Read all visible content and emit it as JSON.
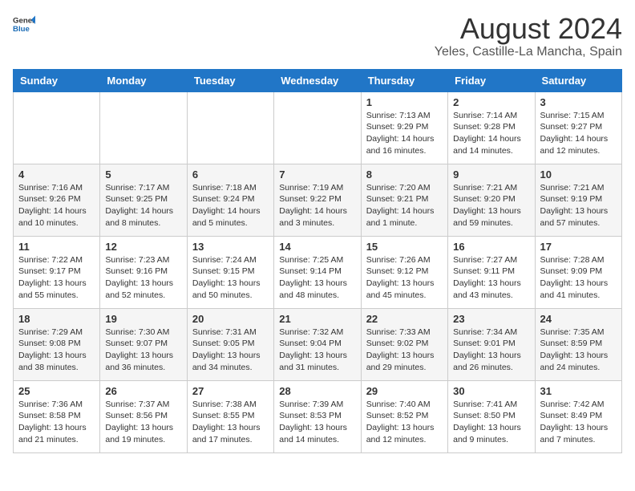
{
  "header": {
    "logo_general": "General",
    "logo_blue": "Blue",
    "title": "August 2024",
    "subtitle": "Yeles, Castille-La Mancha, Spain"
  },
  "days_of_week": [
    "Sunday",
    "Monday",
    "Tuesday",
    "Wednesday",
    "Thursday",
    "Friday",
    "Saturday"
  ],
  "weeks": [
    [
      {
        "day": "",
        "info": ""
      },
      {
        "day": "",
        "info": ""
      },
      {
        "day": "",
        "info": ""
      },
      {
        "day": "",
        "info": ""
      },
      {
        "day": "1",
        "info": "Sunrise: 7:13 AM\nSunset: 9:29 PM\nDaylight: 14 hours\nand 16 minutes."
      },
      {
        "day": "2",
        "info": "Sunrise: 7:14 AM\nSunset: 9:28 PM\nDaylight: 14 hours\nand 14 minutes."
      },
      {
        "day": "3",
        "info": "Sunrise: 7:15 AM\nSunset: 9:27 PM\nDaylight: 14 hours\nand 12 minutes."
      }
    ],
    [
      {
        "day": "4",
        "info": "Sunrise: 7:16 AM\nSunset: 9:26 PM\nDaylight: 14 hours\nand 10 minutes."
      },
      {
        "day": "5",
        "info": "Sunrise: 7:17 AM\nSunset: 9:25 PM\nDaylight: 14 hours\nand 8 minutes."
      },
      {
        "day": "6",
        "info": "Sunrise: 7:18 AM\nSunset: 9:24 PM\nDaylight: 14 hours\nand 5 minutes."
      },
      {
        "day": "7",
        "info": "Sunrise: 7:19 AM\nSunset: 9:22 PM\nDaylight: 14 hours\nand 3 minutes."
      },
      {
        "day": "8",
        "info": "Sunrise: 7:20 AM\nSunset: 9:21 PM\nDaylight: 14 hours\nand 1 minute."
      },
      {
        "day": "9",
        "info": "Sunrise: 7:21 AM\nSunset: 9:20 PM\nDaylight: 13 hours\nand 59 minutes."
      },
      {
        "day": "10",
        "info": "Sunrise: 7:21 AM\nSunset: 9:19 PM\nDaylight: 13 hours\nand 57 minutes."
      }
    ],
    [
      {
        "day": "11",
        "info": "Sunrise: 7:22 AM\nSunset: 9:17 PM\nDaylight: 13 hours\nand 55 minutes."
      },
      {
        "day": "12",
        "info": "Sunrise: 7:23 AM\nSunset: 9:16 PM\nDaylight: 13 hours\nand 52 minutes."
      },
      {
        "day": "13",
        "info": "Sunrise: 7:24 AM\nSunset: 9:15 PM\nDaylight: 13 hours\nand 50 minutes."
      },
      {
        "day": "14",
        "info": "Sunrise: 7:25 AM\nSunset: 9:14 PM\nDaylight: 13 hours\nand 48 minutes."
      },
      {
        "day": "15",
        "info": "Sunrise: 7:26 AM\nSunset: 9:12 PM\nDaylight: 13 hours\nand 45 minutes."
      },
      {
        "day": "16",
        "info": "Sunrise: 7:27 AM\nSunset: 9:11 PM\nDaylight: 13 hours\nand 43 minutes."
      },
      {
        "day": "17",
        "info": "Sunrise: 7:28 AM\nSunset: 9:09 PM\nDaylight: 13 hours\nand 41 minutes."
      }
    ],
    [
      {
        "day": "18",
        "info": "Sunrise: 7:29 AM\nSunset: 9:08 PM\nDaylight: 13 hours\nand 38 minutes."
      },
      {
        "day": "19",
        "info": "Sunrise: 7:30 AM\nSunset: 9:07 PM\nDaylight: 13 hours\nand 36 minutes."
      },
      {
        "day": "20",
        "info": "Sunrise: 7:31 AM\nSunset: 9:05 PM\nDaylight: 13 hours\nand 34 minutes."
      },
      {
        "day": "21",
        "info": "Sunrise: 7:32 AM\nSunset: 9:04 PM\nDaylight: 13 hours\nand 31 minutes."
      },
      {
        "day": "22",
        "info": "Sunrise: 7:33 AM\nSunset: 9:02 PM\nDaylight: 13 hours\nand 29 minutes."
      },
      {
        "day": "23",
        "info": "Sunrise: 7:34 AM\nSunset: 9:01 PM\nDaylight: 13 hours\nand 26 minutes."
      },
      {
        "day": "24",
        "info": "Sunrise: 7:35 AM\nSunset: 8:59 PM\nDaylight: 13 hours\nand 24 minutes."
      }
    ],
    [
      {
        "day": "25",
        "info": "Sunrise: 7:36 AM\nSunset: 8:58 PM\nDaylight: 13 hours\nand 21 minutes."
      },
      {
        "day": "26",
        "info": "Sunrise: 7:37 AM\nSunset: 8:56 PM\nDaylight: 13 hours\nand 19 minutes."
      },
      {
        "day": "27",
        "info": "Sunrise: 7:38 AM\nSunset: 8:55 PM\nDaylight: 13 hours\nand 17 minutes."
      },
      {
        "day": "28",
        "info": "Sunrise: 7:39 AM\nSunset: 8:53 PM\nDaylight: 13 hours\nand 14 minutes."
      },
      {
        "day": "29",
        "info": "Sunrise: 7:40 AM\nSunset: 8:52 PM\nDaylight: 13 hours\nand 12 minutes."
      },
      {
        "day": "30",
        "info": "Sunrise: 7:41 AM\nSunset: 8:50 PM\nDaylight: 13 hours\nand 9 minutes."
      },
      {
        "day": "31",
        "info": "Sunrise: 7:42 AM\nSunset: 8:49 PM\nDaylight: 13 hours\nand 7 minutes."
      }
    ]
  ]
}
